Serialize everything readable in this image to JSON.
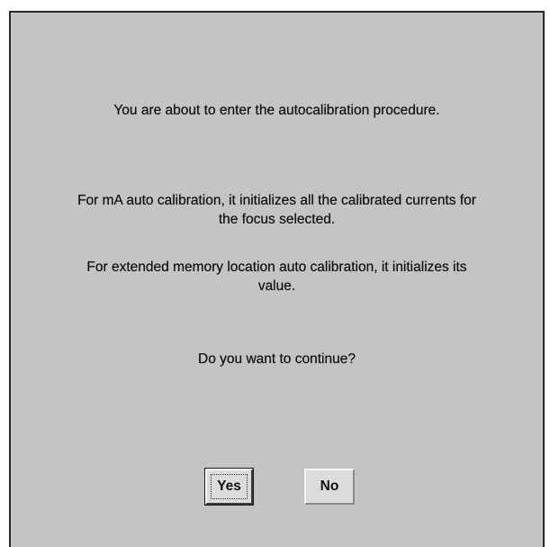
{
  "dialog": {
    "intro": "You are about to enter the autocalibration procedure.",
    "ma_line1": "For mA auto calibration,  it initializes all the calibrated currents for",
    "ma_line2": "the focus selected.",
    "ext_line1": "For extended memory location auto calibration,  it initializes its",
    "ext_line2": "value.",
    "question": "Do you want to continue?",
    "yes_label": "Yes",
    "no_label": "No"
  }
}
